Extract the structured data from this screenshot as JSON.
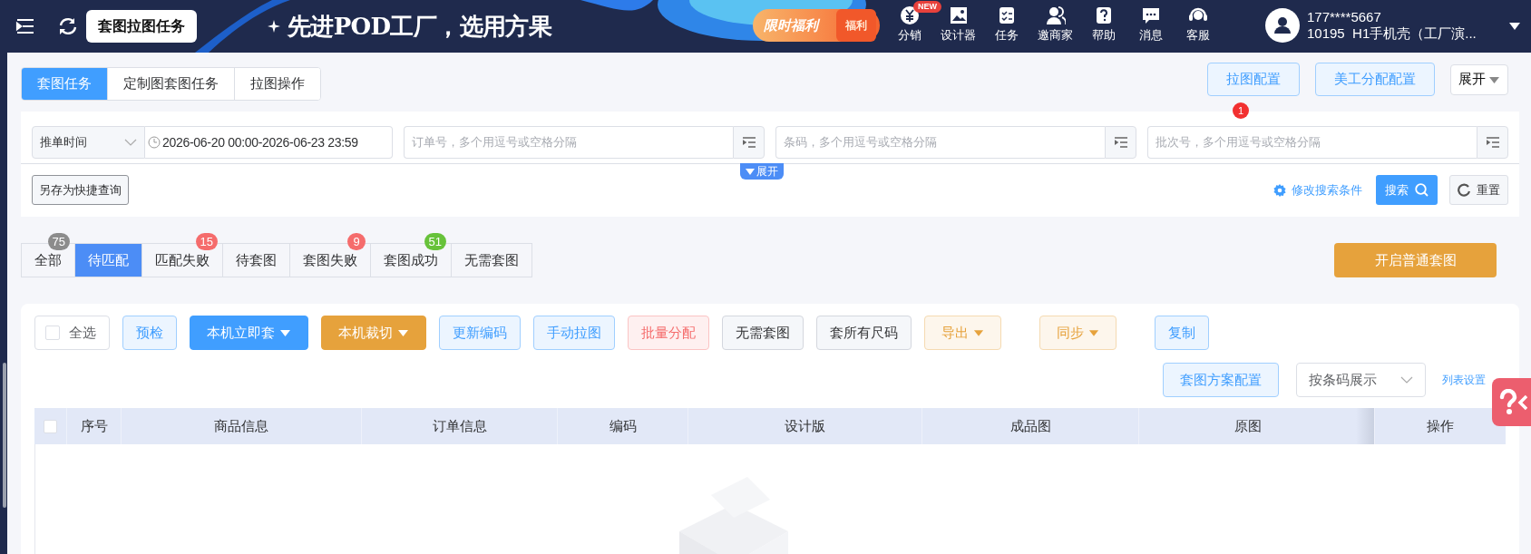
{
  "header": {
    "page_title": "套图拉图任务",
    "slogan": "先进POD工厂，选用方果",
    "promo": {
      "label": "限时福利",
      "tag": "福利"
    },
    "nav": [
      {
        "label": "分销",
        "badge": "NEW"
      },
      {
        "label": "设计器"
      },
      {
        "label": "任务"
      },
      {
        "label": "邀商家"
      },
      {
        "label": "帮助"
      },
      {
        "label": "消息"
      },
      {
        "label": "客服"
      }
    ],
    "user": {
      "phone": "177****5667",
      "org": "10195  H1手机壳（工厂演..."
    }
  },
  "mode_tabs": [
    {
      "label": "套图任务",
      "selected": true
    },
    {
      "label": "定制图套图任务",
      "selected": false
    },
    {
      "label": "拉图操作",
      "selected": false
    }
  ],
  "config_buttons": [
    {
      "label": "拉图配置",
      "badge": "1"
    },
    {
      "label": "美工分配配置"
    }
  ],
  "expand_dropdown": "展开",
  "filters": {
    "time_type": "推单时间",
    "date_range": "2026-06-20 00:00-2026-06-23 23:59",
    "fields": [
      {
        "placeholder": "订单号，多个用逗号或空格分隔"
      },
      {
        "placeholder": "条码，多个用逗号或空格分隔"
      },
      {
        "placeholder": "批次号，多个用逗号或空格分隔"
      }
    ],
    "expand_toggle": "展开",
    "save_query": "另存为快捷查询",
    "edit_conditions": "修改搜索条件",
    "search": "搜索",
    "reset": "重置"
  },
  "status_tabs": [
    {
      "label": "全部",
      "count": "75",
      "color": "#8c8c8c",
      "selected": false
    },
    {
      "label": "待匹配",
      "selected": true
    },
    {
      "label": "匹配失败",
      "count": "15",
      "color": "#f56c6c",
      "selected": false
    },
    {
      "label": "待套图",
      "selected": false
    },
    {
      "label": "套图失败",
      "count": "9",
      "color": "#f56c6c",
      "selected": false
    },
    {
      "label": "套图成功",
      "count": "51",
      "color": "#67c23a",
      "selected": false
    },
    {
      "label": "无需套图",
      "selected": false
    }
  ],
  "start_button": "开启普通套图",
  "actions": [
    {
      "label": "全选",
      "kind": "checkbox",
      "checked": false
    },
    {
      "label": "预检",
      "kind": "light"
    },
    {
      "label": "本机立即套",
      "kind": "primary",
      "dropdown": true
    },
    {
      "label": "本机裁切",
      "kind": "warning",
      "dropdown": true
    },
    {
      "label": "更新编码",
      "kind": "light"
    },
    {
      "label": "手动拉图",
      "kind": "light"
    },
    {
      "label": "批量分配",
      "kind": "danger"
    },
    {
      "label": "无需套图",
      "kind": "plain"
    },
    {
      "label": "套所有尺码",
      "kind": "plain"
    },
    {
      "label": "导出",
      "kind": "warning_light",
      "dropdown": true
    },
    {
      "label": "同步",
      "kind": "warning_light",
      "dropdown": true
    },
    {
      "label": "复制",
      "kind": "light"
    }
  ],
  "second_row": {
    "scheme_button": "套图方案配置",
    "display_select": "按条码展示",
    "list_settings": "列表设置"
  },
  "table": {
    "select_all_checked": false,
    "columns": [
      "序号",
      "商品信息",
      "订单信息",
      "编码",
      "设计版",
      "成品图",
      "原图",
      "操作"
    ]
  }
}
